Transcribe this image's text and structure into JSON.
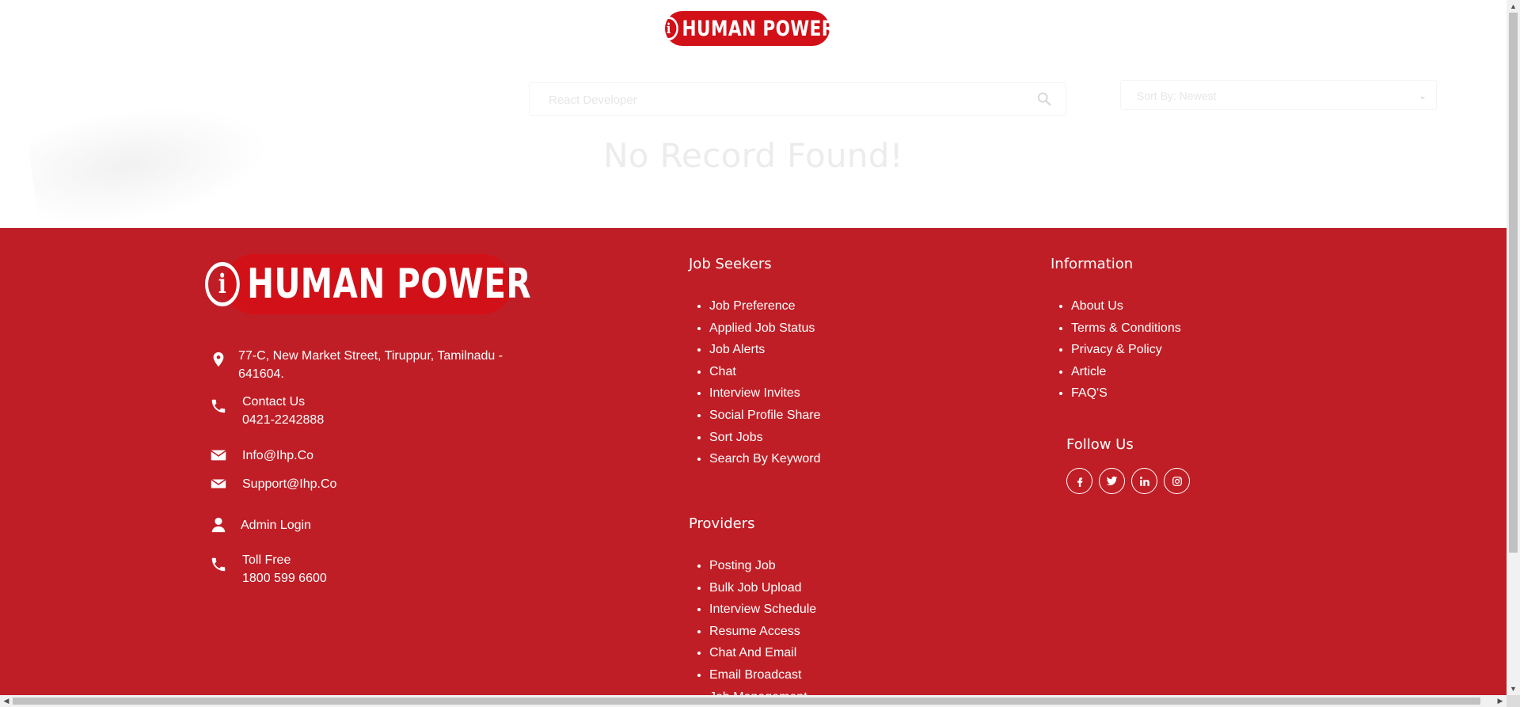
{
  "brand": {
    "name": "HUMAN POWER",
    "logo_mark": "i",
    "color": "#d21018"
  },
  "search": {
    "placeholder": "React Developer",
    "icon": "search-icon"
  },
  "sort": {
    "selected": "Sort By: Newest",
    "icon": "chevron-down-icon"
  },
  "results": {
    "message": "No Record Found!"
  },
  "footer": {
    "background": "#c01e26",
    "address": {
      "line1": "77-C, New Market Street, Tiruppur, Tamilnadu -",
      "line2": "641604.",
      "icon": "location-pin-icon"
    },
    "contact": {
      "label": "Contact Us",
      "phone": "0421-2242888",
      "icon": "phone-icon"
    },
    "emails": [
      {
        "value": "Info@Ihp.Co",
        "icon": "envelope-icon"
      },
      {
        "value": "Support@Ihp.Co",
        "icon": "envelope-icon"
      }
    ],
    "admin_login": {
      "label": "Admin Login",
      "icon": "user-icon"
    },
    "toll_free": {
      "label": "Toll Free",
      "number": "1800 599 6600",
      "icon": "phone-icon"
    },
    "job_seekers": {
      "title": "Job Seekers",
      "links": [
        "Job Preference",
        "Applied Job Status",
        "Job Alerts",
        "Chat",
        "Interview Invites",
        "Social Profile Share",
        "Sort Jobs",
        "Search By Keyword"
      ]
    },
    "providers": {
      "title": "Providers",
      "links": [
        "Posting Job",
        "Bulk Job Upload",
        "Interview Schedule",
        "Resume Access",
        "Chat And Email",
        "Email Broadcast",
        "Job Management"
      ]
    },
    "information": {
      "title": "Information",
      "links": [
        "About Us",
        "Terms & Conditions",
        "Privacy & Policy",
        "Article",
        "FAQ'S"
      ]
    },
    "follow_us": {
      "title": "Follow Us",
      "networks": [
        {
          "name": "facebook",
          "glyph": "f"
        },
        {
          "name": "twitter",
          "glyph": "t"
        },
        {
          "name": "linkedin",
          "glyph": "in"
        },
        {
          "name": "instagram",
          "glyph": "◎"
        }
      ]
    }
  }
}
